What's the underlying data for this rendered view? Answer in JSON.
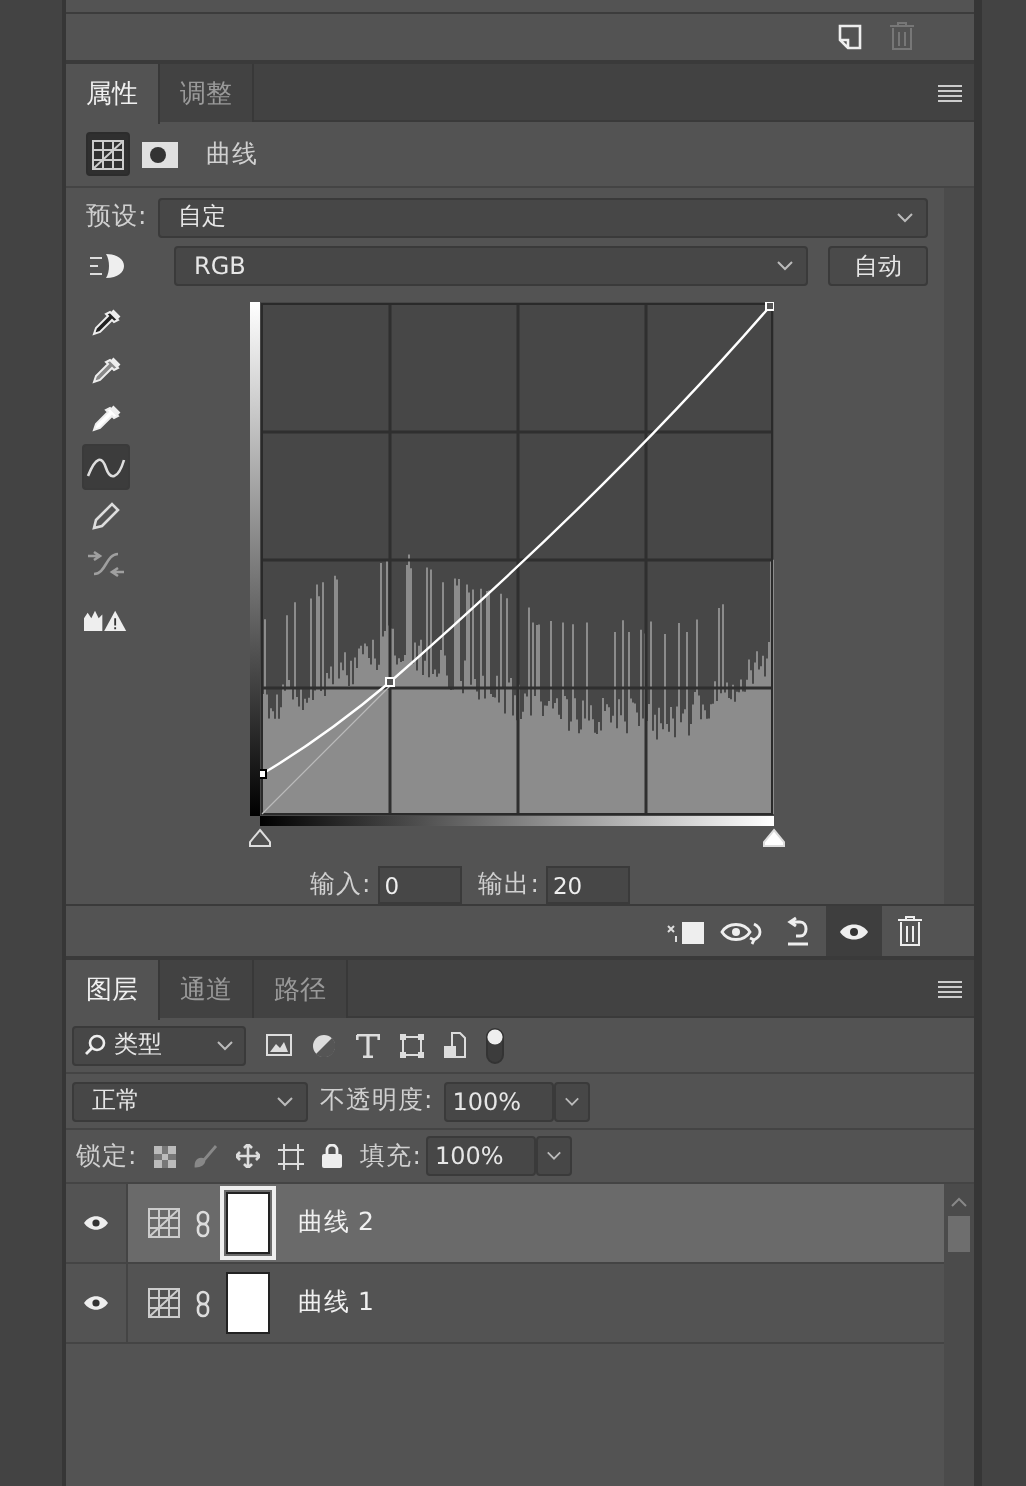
{
  "properties": {
    "tabs": [
      {
        "label": "属性",
        "selected": true
      },
      {
        "label": "调整",
        "selected": false
      }
    ],
    "header": {
      "title": "曲线",
      "modes": [
        {
          "kind": "adjustment",
          "selected": true
        },
        {
          "kind": "mask",
          "selected": false
        }
      ]
    },
    "preset": {
      "label": "预设:",
      "value": "自定"
    },
    "channel": {
      "value": "RGB"
    },
    "auto_button": "自动",
    "tools": [
      {
        "kind": "eyedropper-dark",
        "selected": false,
        "disabled": false
      },
      {
        "kind": "eyedropper-mid",
        "selected": false,
        "disabled": false
      },
      {
        "kind": "eyedropper-light",
        "selected": false,
        "disabled": false
      },
      {
        "kind": "curve",
        "selected": true,
        "disabled": false
      },
      {
        "kind": "pencil",
        "selected": false,
        "disabled": false
      },
      {
        "kind": "smooth",
        "selected": false,
        "disabled": true
      },
      {
        "kind": "clipping",
        "selected": false,
        "disabled": false
      }
    ],
    "input_sliders": [
      {
        "kind": "shadow",
        "level": 0
      },
      {
        "kind": "highlight",
        "level": 1
      }
    ],
    "input": {
      "label": "输入:",
      "value": "0"
    },
    "output": {
      "label": "输出:",
      "value": "20"
    },
    "visibility_on": true
  },
  "layers_panel": {
    "tabs": [
      {
        "label": "图层",
        "selected": true
      },
      {
        "label": "通道",
        "selected": false
      },
      {
        "label": "路径",
        "selected": false
      }
    ],
    "filter": {
      "value": "类型"
    },
    "blend_mode": "正常",
    "opacity": {
      "label": "不透明度:",
      "value": "100%"
    },
    "lock": {
      "label": "锁定:"
    },
    "fill": {
      "label": "填充:",
      "value": "100%"
    },
    "layers": [
      {
        "name": "曲线 2",
        "selected": true,
        "visible": true
      },
      {
        "name": "曲线 1",
        "selected": false,
        "visible": true
      }
    ]
  }
}
